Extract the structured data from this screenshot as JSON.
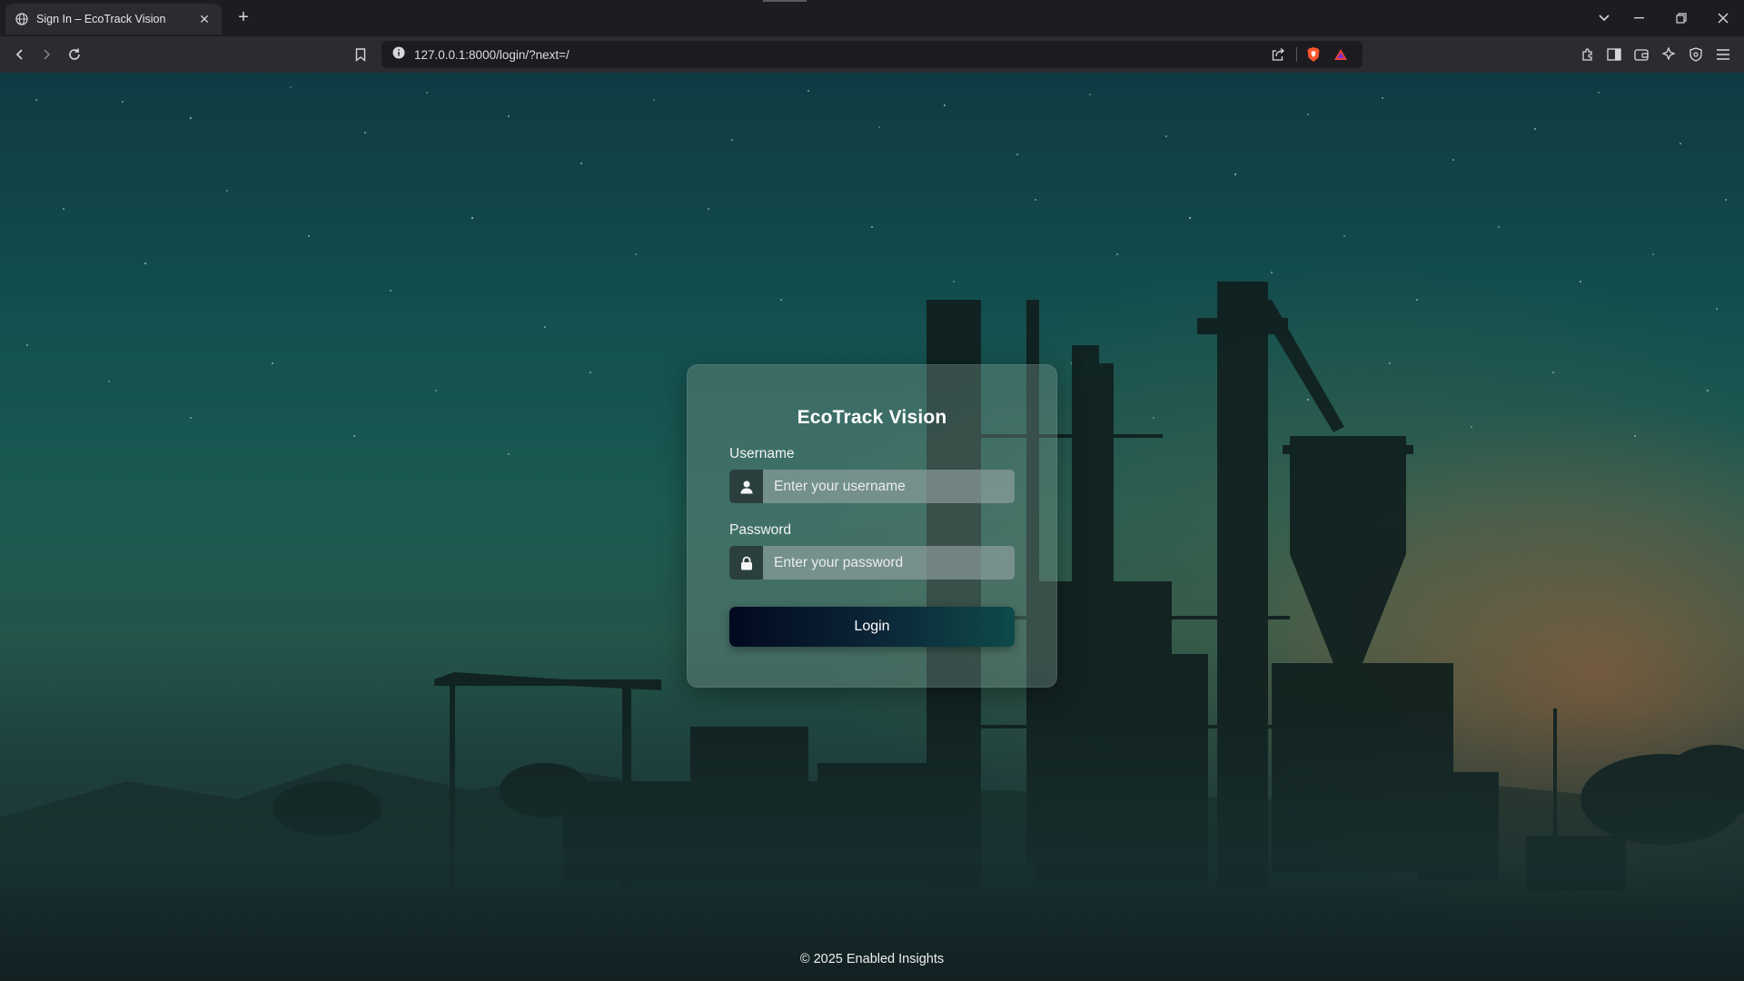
{
  "browser": {
    "tab_title": "Sign In – EcoTrack Vision",
    "url": "127.0.0.1:8000/login/?next=/"
  },
  "login": {
    "title": "EcoTrack Vision",
    "username_label": "Username",
    "username_placeholder": "Enter your username",
    "password_label": "Password",
    "password_placeholder": "Enter your password",
    "button_label": "Login"
  },
  "footer": {
    "text": "© 2025 Enabled Insights"
  },
  "icons": {
    "username_field": "user-icon",
    "password_field": "lock-icon"
  },
  "colors": {
    "button_gradient_start": "#020920",
    "button_gradient_end": "#0e4a4a",
    "brave_accent": "#fb542b"
  }
}
